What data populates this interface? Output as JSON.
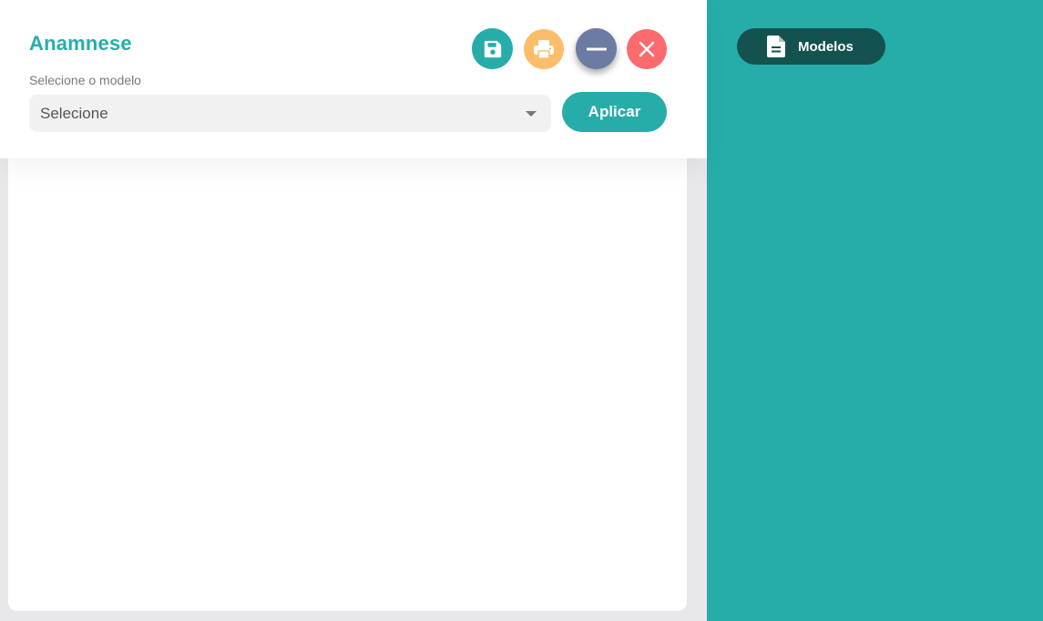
{
  "header": {
    "title": "Anamnese",
    "select_label": "Selecione o modelo",
    "select_value": "Selecione",
    "apply_label": "Aplicar"
  },
  "actions": {
    "save_icon": "floppy-disk-icon",
    "print_icon": "printer-icon",
    "minimize_icon": "minus-icon",
    "close_icon": "close-x-icon"
  },
  "sidebar": {
    "models_label": "Modelos",
    "models_icon": "document-icon"
  },
  "colors": {
    "accent": "#26ada9",
    "print": "#fcbd6a",
    "minimize": "#6c7ba1",
    "close": "#fb6b6e",
    "models_button": "#13524f"
  }
}
